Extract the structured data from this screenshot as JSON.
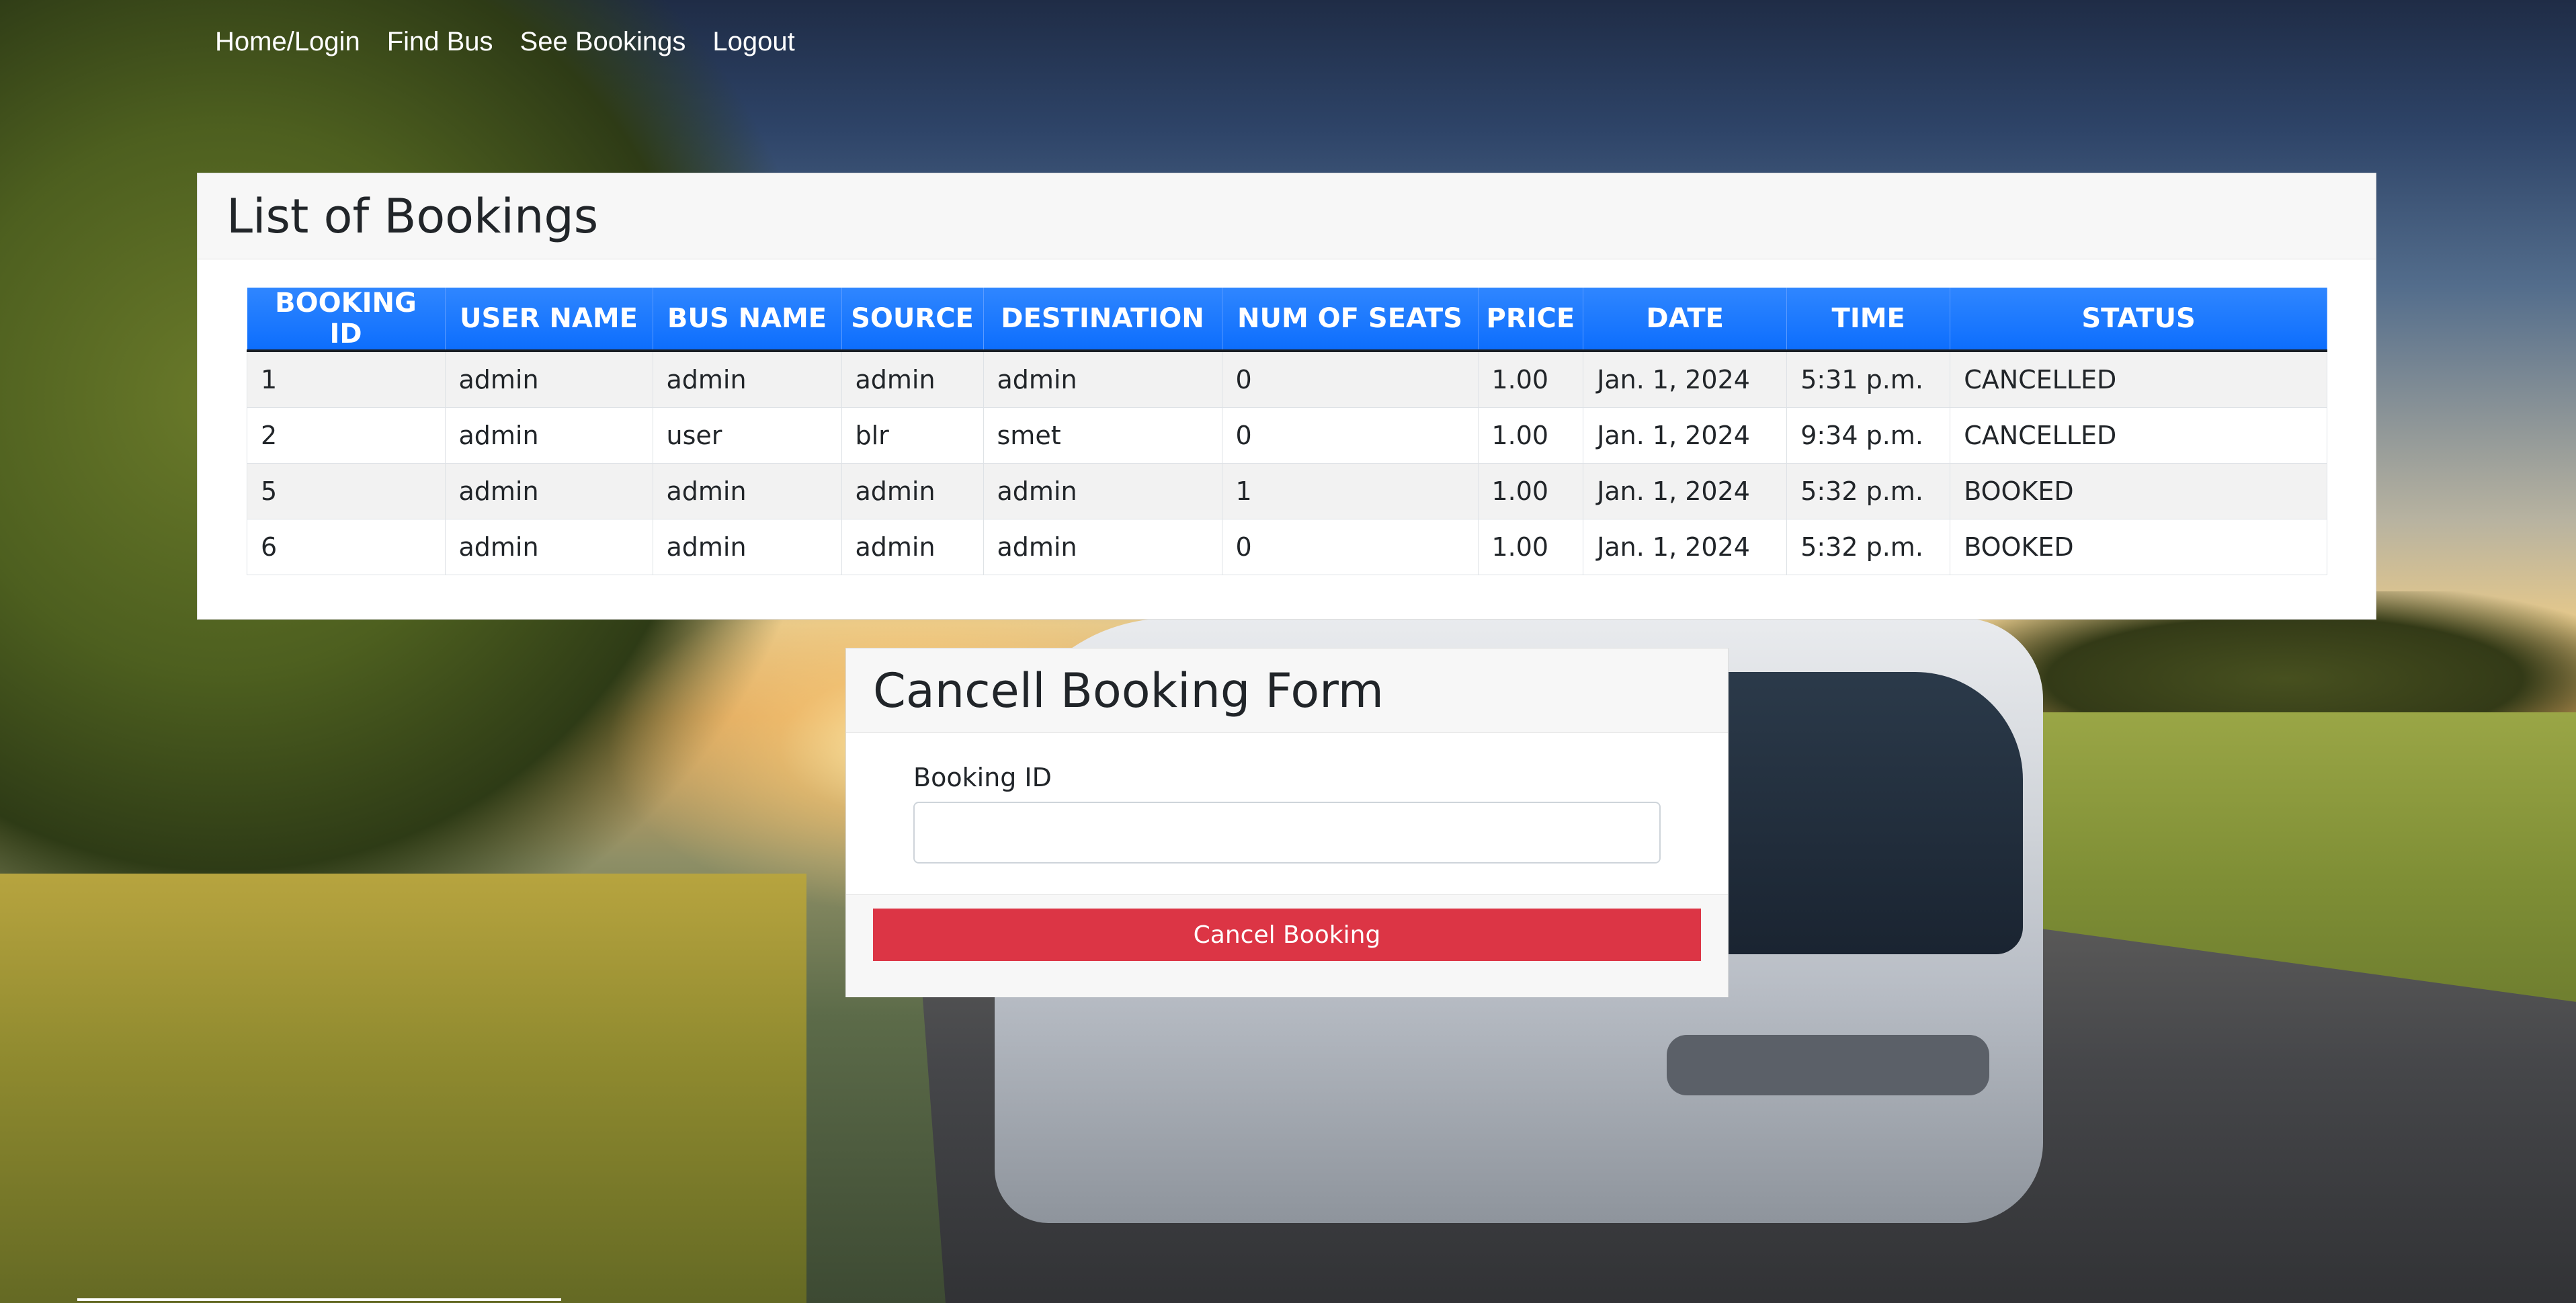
{
  "nav": {
    "links": [
      "Home/Login",
      "Find Bus",
      "See Bookings",
      "Logout"
    ]
  },
  "bookings": {
    "title": "List of Bookings",
    "columns": [
      "BOOKING ID",
      "USER NAME",
      "BUS NAME",
      "SOURCE",
      "DESTINATION",
      "NUM OF SEATS",
      "PRICE",
      "DATE",
      "TIME",
      "STATUS"
    ],
    "rows": [
      [
        "1",
        "admin",
        "admin",
        "admin",
        "admin",
        "0",
        "1.00",
        "Jan. 1, 2024",
        "5:31 p.m.",
        "CANCELLED"
      ],
      [
        "2",
        "admin",
        "user",
        "blr",
        "smet",
        "0",
        "1.00",
        "Jan. 1, 2024",
        "9:34 p.m.",
        "CANCELLED"
      ],
      [
        "5",
        "admin",
        "admin",
        "admin",
        "admin",
        "1",
        "1.00",
        "Jan. 1, 2024",
        "5:32 p.m.",
        "BOOKED"
      ],
      [
        "6",
        "admin",
        "admin",
        "admin",
        "admin",
        "0",
        "1.00",
        "Jan. 1, 2024",
        "5:32 p.m.",
        "BOOKED"
      ]
    ]
  },
  "cancel_form": {
    "title": "Cancell Booking Form",
    "booking_id_label": "Booking ID",
    "booking_id_value": "",
    "submit_label": "Cancel Booking"
  },
  "colors": {
    "table_header": "#0d6efd",
    "cancel_button": "#dc3545"
  }
}
